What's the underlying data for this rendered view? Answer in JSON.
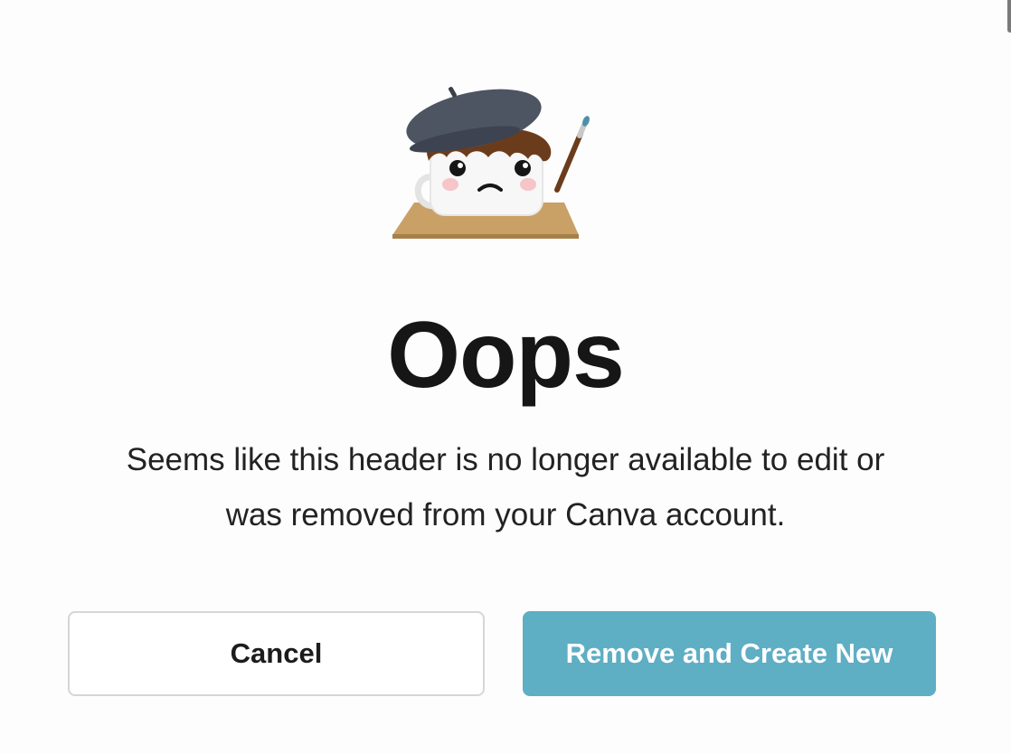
{
  "dialog": {
    "title": "Oops",
    "message_line1": "Seems like this header is no longer available to edit or",
    "message_line2": "was removed from your Canva account.",
    "illustration": "sad-mug-artist-illustration"
  },
  "actions": {
    "cancel_label": "Cancel",
    "primary_label": "Remove and Create New"
  },
  "colors": {
    "primary": "#5eaec4",
    "text": "#161616",
    "border": "#d6d6d6"
  }
}
